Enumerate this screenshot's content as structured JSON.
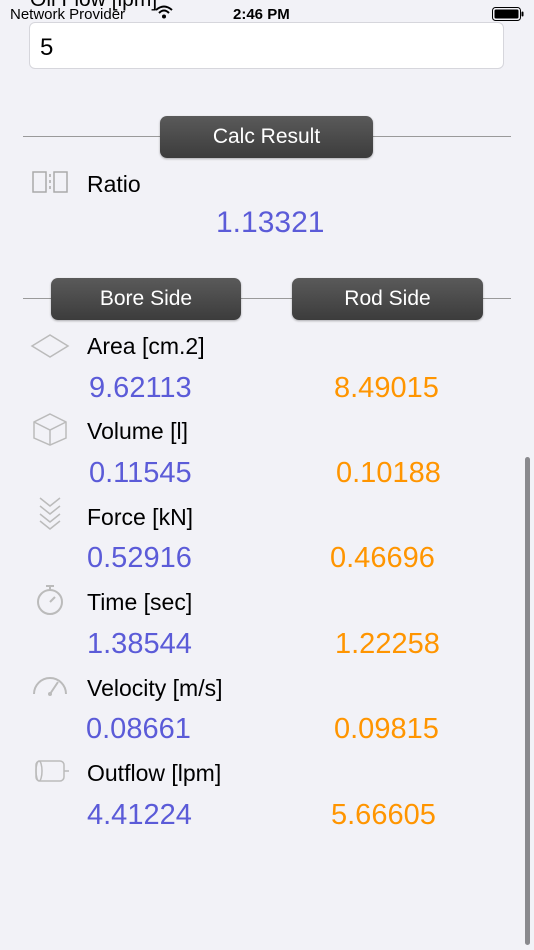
{
  "status": {
    "carrier": "Network Provider",
    "time": "2:46 PM"
  },
  "field": {
    "label": "Oil Flow [lpm]",
    "value": "5"
  },
  "buttons": {
    "calc_result": "Calc Result",
    "bore_side": "Bore Side",
    "rod_side": "Rod Side"
  },
  "ratio": {
    "label": "Ratio",
    "value": "1.13321"
  },
  "rows": [
    {
      "label": "Area [cm.2]",
      "bore": "9.62113",
      "rod": "8.49015",
      "icon": "area-icon"
    },
    {
      "label": "Volume  [l]",
      "bore": "0.11545",
      "rod": "0.10188",
      "icon": "volume-icon"
    },
    {
      "label": "Force [kN]",
      "bore": "0.52916",
      "rod": "0.46696",
      "icon": "force-icon"
    },
    {
      "label": "Time [sec]",
      "bore": "1.38544",
      "rod": "1.22258",
      "icon": "stopwatch-icon"
    },
    {
      "label": "Velocity [m/s]",
      "bore": "0.08661",
      "rod": "0.09815",
      "icon": "gauge-icon"
    },
    {
      "label": "Outflow [lpm]",
      "bore": "4.41224",
      "rod": "5.66605",
      "icon": "cylinder-icon"
    }
  ],
  "colors": {
    "bore": "#5b5bd8",
    "rod": "#ff9500",
    "button": "#4a4a4a"
  }
}
